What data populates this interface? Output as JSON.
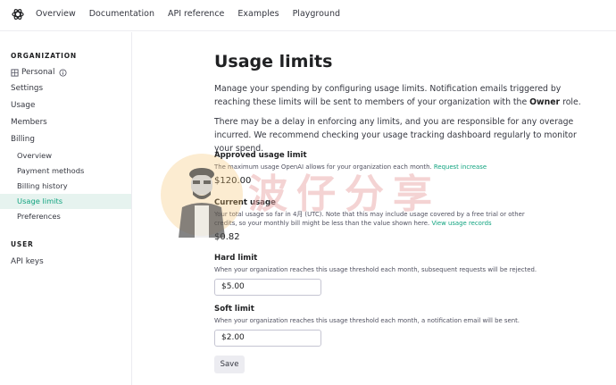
{
  "topnav": {
    "links": [
      "Overview",
      "Documentation",
      "API reference",
      "Examples",
      "Playground"
    ]
  },
  "sidebar": {
    "org_heading": "ORGANIZATION",
    "personal": "Personal",
    "items": [
      "Settings",
      "Usage",
      "Members",
      "Billing"
    ],
    "billing_items": [
      "Overview",
      "Payment methods",
      "Billing history",
      "Usage limits",
      "Preferences"
    ],
    "user_heading": "USER",
    "user_items": [
      "API keys"
    ]
  },
  "main": {
    "title": "Usage limits",
    "intro_1a": "Manage your spending by configuring usage limits. Notification emails triggered by reaching these limits will be sent to members of your organization with the ",
    "intro_1b": "Owner",
    "intro_1c": " role.",
    "intro_2": "There may be a delay in enforcing any limits, and you are responsible for any overage incurred. We recommend checking your usage tracking dashboard regularly to monitor your spend.",
    "approved": {
      "title": "Approved usage limit",
      "desc": "The maximum usage OpenAI allows for your organization each month. ",
      "link": "Request increase",
      "amount": "$120.00"
    },
    "current": {
      "title": "Current usage",
      "desc": "Your total usage so far in 4月 (UTC). Note that this may include usage covered by a free trial or other credits, so your monthly bill might be less than the value shown here. ",
      "link": "View usage records",
      "amount": "$0.82"
    },
    "hard": {
      "title": "Hard limit",
      "desc": "When your organization reaches this usage threshold each month, subsequent requests will be rejected.",
      "value": "$5.00"
    },
    "soft": {
      "title": "Soft limit",
      "desc": "When your organization reaches this usage threshold each month, a notification email will be sent.",
      "value": "$2.00"
    },
    "save_label": "Save"
  },
  "watermark": {
    "text": "波仔分享"
  },
  "colors": {
    "accent": "#10a37f",
    "active_bg": "#e6f3ef"
  }
}
